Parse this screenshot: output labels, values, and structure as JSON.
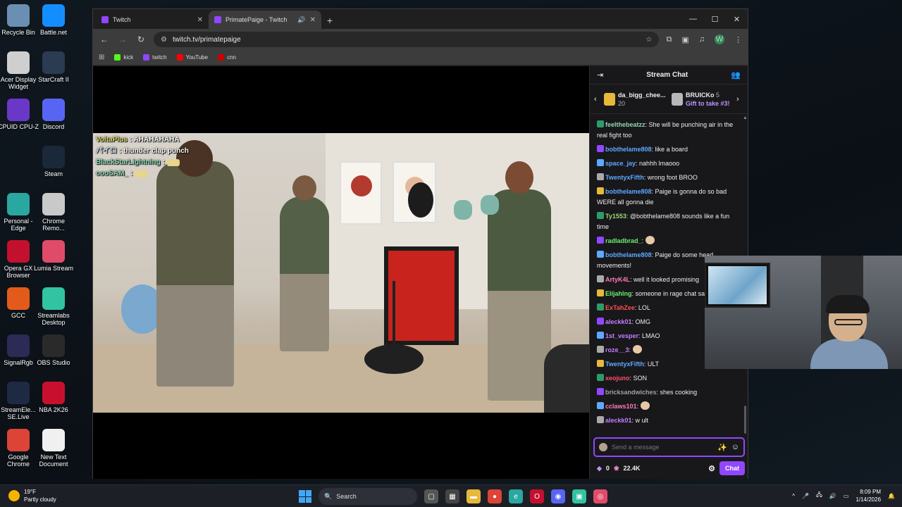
{
  "desktop": {
    "icons_left": [
      {
        "label": "Recycle Bin",
        "icon": "recycle-bin-icon",
        "color": "#6b8fb3"
      },
      {
        "label": "Acer Display Widget",
        "icon": "display-widget-icon",
        "color": "#cfcfcf"
      },
      {
        "label": "CPUID CPU-Z",
        "icon": "cpu-z-icon",
        "color": "#6a38c9"
      },
      {
        "label": "",
        "icon": "blank-icon",
        "color": "transparent"
      },
      {
        "label": "Personal - Edge",
        "icon": "edge-icon",
        "color": "#2aa7a0"
      },
      {
        "label": "Opera GX Browser",
        "icon": "opera-gx-icon",
        "color": "#c3102e"
      },
      {
        "label": "GCC",
        "icon": "gcc-icon",
        "color": "#e35b1a"
      },
      {
        "label": "SignalRgb",
        "icon": "signalrgb-icon",
        "color": "#2b2b55"
      },
      {
        "label": "StreamEle... SE.Live",
        "icon": "streamelements-icon",
        "color": "#1e2a44"
      },
      {
        "label": "Google Chrome",
        "icon": "chrome-icon",
        "color": "#db4437"
      }
    ],
    "icons_right": [
      {
        "label": "Battle.net",
        "icon": "battlenet-icon",
        "color": "#148eff"
      },
      {
        "label": "StarCraft II",
        "icon": "starcraft-icon",
        "color": "#2a3b52"
      },
      {
        "label": "Discord",
        "icon": "discord-icon",
        "color": "#5865f2"
      },
      {
        "label": "Steam",
        "icon": "steam-icon",
        "color": "#1b2838"
      },
      {
        "label": "Chrome Remo...",
        "icon": "chrome-remote-icon",
        "color": "#c9c9c9"
      },
      {
        "label": "Lumia Stream",
        "icon": "lumia-icon",
        "color": "#e14b6a"
      },
      {
        "label": "Streamlabs Desktop",
        "icon": "streamlabs-icon",
        "color": "#31c3a2"
      },
      {
        "label": "OBS Studio",
        "icon": "obs-icon",
        "color": "#2a2a2a"
      },
      {
        "label": "NBA 2K26",
        "icon": "nba2k-icon",
        "color": "#c8102e"
      },
      {
        "label": "New Text Document",
        "icon": "text-document-icon",
        "color": "#f0f0f0"
      }
    ]
  },
  "browser": {
    "tabs": [
      {
        "label": "Twitch",
        "active": false
      },
      {
        "label": "PrimatePaige - Twitch",
        "active": true
      }
    ],
    "url": "twitch.tv/primatepaige",
    "bookmarks": [
      {
        "label": "kick",
        "color": "#53fc18"
      },
      {
        "label": "twitch",
        "color": "#9146ff"
      },
      {
        "label": "YouTube",
        "color": "#ff0000"
      },
      {
        "label": "cnn",
        "color": "#cc0000"
      }
    ],
    "profile_initial": "W"
  },
  "stream_overlay_chat": [
    {
      "name": "VoltaPlus",
      "text": ": AHAHAHAHA"
    },
    {
      "name": "パイロ",
      "text": ": thunder clap punch"
    },
    {
      "name": "BlackStarLightning",
      "text": ":"
    },
    {
      "name": "oooSAM_",
      "text": ":"
    }
  ],
  "chat": {
    "title": "Stream Chat",
    "gifters": [
      {
        "name": "da_bigg_chee...",
        "count": "20"
      },
      {
        "name": "BRUICKo",
        "count": "5",
        "sub": "Gift to take #3!"
      }
    ],
    "messages": [
      {
        "user": "feelthebeatzz",
        "color": "#8fd6b5",
        "text": ": She will be punching air in the real fight too"
      },
      {
        "user": "bobthelame808",
        "color": "#5ea9ff",
        "text": ": like a board"
      },
      {
        "user": "space_jay",
        "color": "#5ea9ff",
        "text": ": nahhh lmaooo"
      },
      {
        "user": "TwentyxFifth",
        "color": "#5ea9ff",
        "text": ": wrong foot BROO"
      },
      {
        "user": "bobthelame808",
        "color": "#5ea9ff",
        "text": ": Paige is gonna do so bad WERE all gonna die"
      },
      {
        "user": "Ty1553",
        "color": "#9ad86e",
        "text": ": @bobthelame808 sounds like a fun time"
      },
      {
        "user": "radladbrad_",
        "color": "#6bf06b",
        "text": ":"
      },
      {
        "user": "bobthelame808",
        "color": "#5ea9ff",
        "text": ": Paige do some head movements!"
      },
      {
        "user": "ArtyK4L",
        "color": "#ff7ab8",
        "text": ": well it looked promising"
      },
      {
        "user": "Elijahlng",
        "color": "#6bf06b",
        "text": ": someone in rage chat said"
      },
      {
        "user": "ExTahZee",
        "color": "#ff4f4f",
        "text": ": LOL"
      },
      {
        "user": "aleckk01",
        "color": "#c77dff",
        "text": ": OMG"
      },
      {
        "user": "1st_vesper",
        "color": "#c77dff",
        "text": ": LMAO"
      },
      {
        "user": "roze__3",
        "color": "#c77dff",
        "text": ":"
      },
      {
        "user": "TwentyxFifth",
        "color": "#5ea9ff",
        "text": ": ULT"
      },
      {
        "user": "xeojuno",
        "color": "#ff4f6a",
        "text": ": SON"
      },
      {
        "user": "bricksandwiches",
        "color": "#a0a0a0",
        "text": ": shes cooking"
      },
      {
        "user": "cclaws101",
        "color": "#ff7ab8",
        "text": ":"
      },
      {
        "user": "aleckk01",
        "color": "#c77dff",
        "text": ": w ult"
      }
    ],
    "input_placeholder": "Send a message",
    "points": "0",
    "channel_points": "22.4K",
    "chat_button": "Chat"
  },
  "taskbar": {
    "weather_temp": "19°F",
    "weather_desc": "Partly cloudy",
    "search_label": "Search",
    "time": "8:09 PM",
    "date": "1/14/2026"
  }
}
